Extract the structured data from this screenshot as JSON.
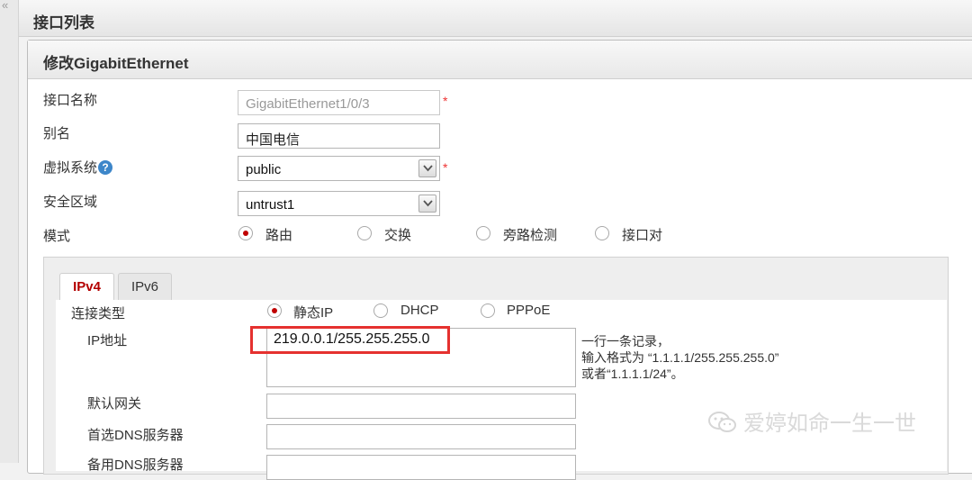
{
  "page": {
    "collapse_glyph": "«",
    "section_title": "接口列表"
  },
  "dialog": {
    "title": "修改GigabitEthernet",
    "fields": {
      "interface_name": {
        "label": "接口名称",
        "value": "GigabitEthernet1/0/3",
        "required": "*"
      },
      "alias": {
        "label": "别名",
        "value": "中国电信"
      },
      "vsys": {
        "label": "虚拟系统",
        "help": "?",
        "value": "public",
        "required": "*"
      },
      "zone": {
        "label": "安全区域",
        "value": "untrust1"
      },
      "mode": {
        "label": "模式",
        "options": [
          "路由",
          "交换",
          "旁路检测",
          "接口对"
        ],
        "selected": "路由"
      }
    },
    "tabs": [
      {
        "label": "IPv4",
        "active": true
      },
      {
        "label": "IPv6",
        "active": false
      }
    ],
    "ipv4": {
      "conn_type_label": "连接类型",
      "conn_options": [
        "静态IP",
        "DHCP",
        "PPPoE"
      ],
      "conn_selected": "静态IP",
      "ip_label": "IP地址",
      "ip_value": "219.0.0.1/255.255.255.0",
      "hint": [
        "一行一条记录，",
        "输入格式为 “1.1.1.1/255.255.255.0”",
        "或者“1.1.1.1/24”。"
      ],
      "gateway_label": "默认网关",
      "dns1_label": "首选DNS服务器",
      "dns2_label": "备用DNS服务器"
    }
  },
  "watermark": "爱婷如命一生一世",
  "colors": {
    "accent_red": "#c00000",
    "highlight_box": "#e5312f",
    "required": "#ee3333"
  }
}
